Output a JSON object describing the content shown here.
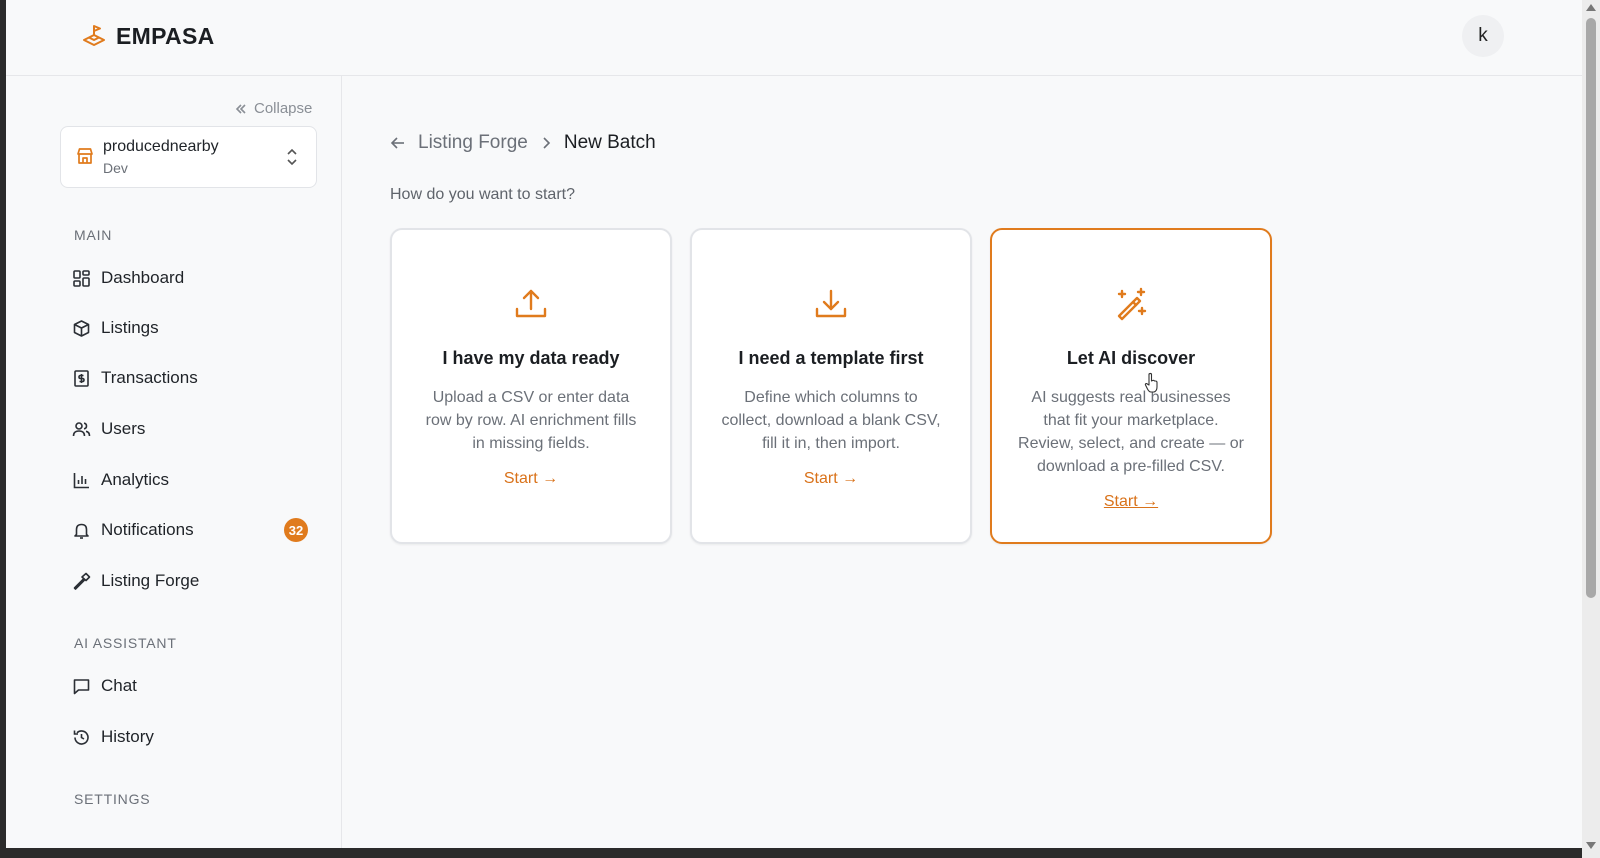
{
  "brand": {
    "name": "EMPASA",
    "accent": "#e07b1d"
  },
  "user": {
    "avatar_initial": "k"
  },
  "sidebar": {
    "collapse_label": "Collapse",
    "org": {
      "name": "producednearby",
      "env": "Dev"
    },
    "sections": {
      "main": "MAIN",
      "ai": "AI ASSISTANT",
      "settings": "SETTINGS"
    },
    "items": [
      {
        "label": "Dashboard",
        "icon": "dashboard-icon"
      },
      {
        "label": "Listings",
        "icon": "package-icon"
      },
      {
        "label": "Transactions",
        "icon": "receipt-icon"
      },
      {
        "label": "Users",
        "icon": "users-icon"
      },
      {
        "label": "Analytics",
        "icon": "bar-chart-icon"
      },
      {
        "label": "Notifications",
        "icon": "bell-icon",
        "badge": "32"
      },
      {
        "label": "Listing Forge",
        "icon": "hammer-icon"
      },
      {
        "label": "Chat",
        "icon": "chat-icon"
      },
      {
        "label": "History",
        "icon": "history-icon"
      }
    ]
  },
  "breadcrumb": {
    "parent": "Listing Forge",
    "current": "New Batch"
  },
  "main": {
    "prompt": "How do you want to start?",
    "cards": [
      {
        "title": "I have my data ready",
        "description": "Upload a CSV or enter data row by row. AI enrichment fills in missing fields.",
        "cta": "Start →",
        "icon": "upload-icon"
      },
      {
        "title": "I need a template first",
        "description": "Define which columns to collect, download a blank CSV, fill it in, then import.",
        "cta": "Start →",
        "icon": "download-icon"
      },
      {
        "title": "Let AI discover",
        "description": "AI suggests real businesses that fit your marketplace. Review, select, and create — or download a pre-filled CSV.",
        "cta": "Start →",
        "icon": "magic-wand-icon",
        "active": true
      }
    ]
  }
}
